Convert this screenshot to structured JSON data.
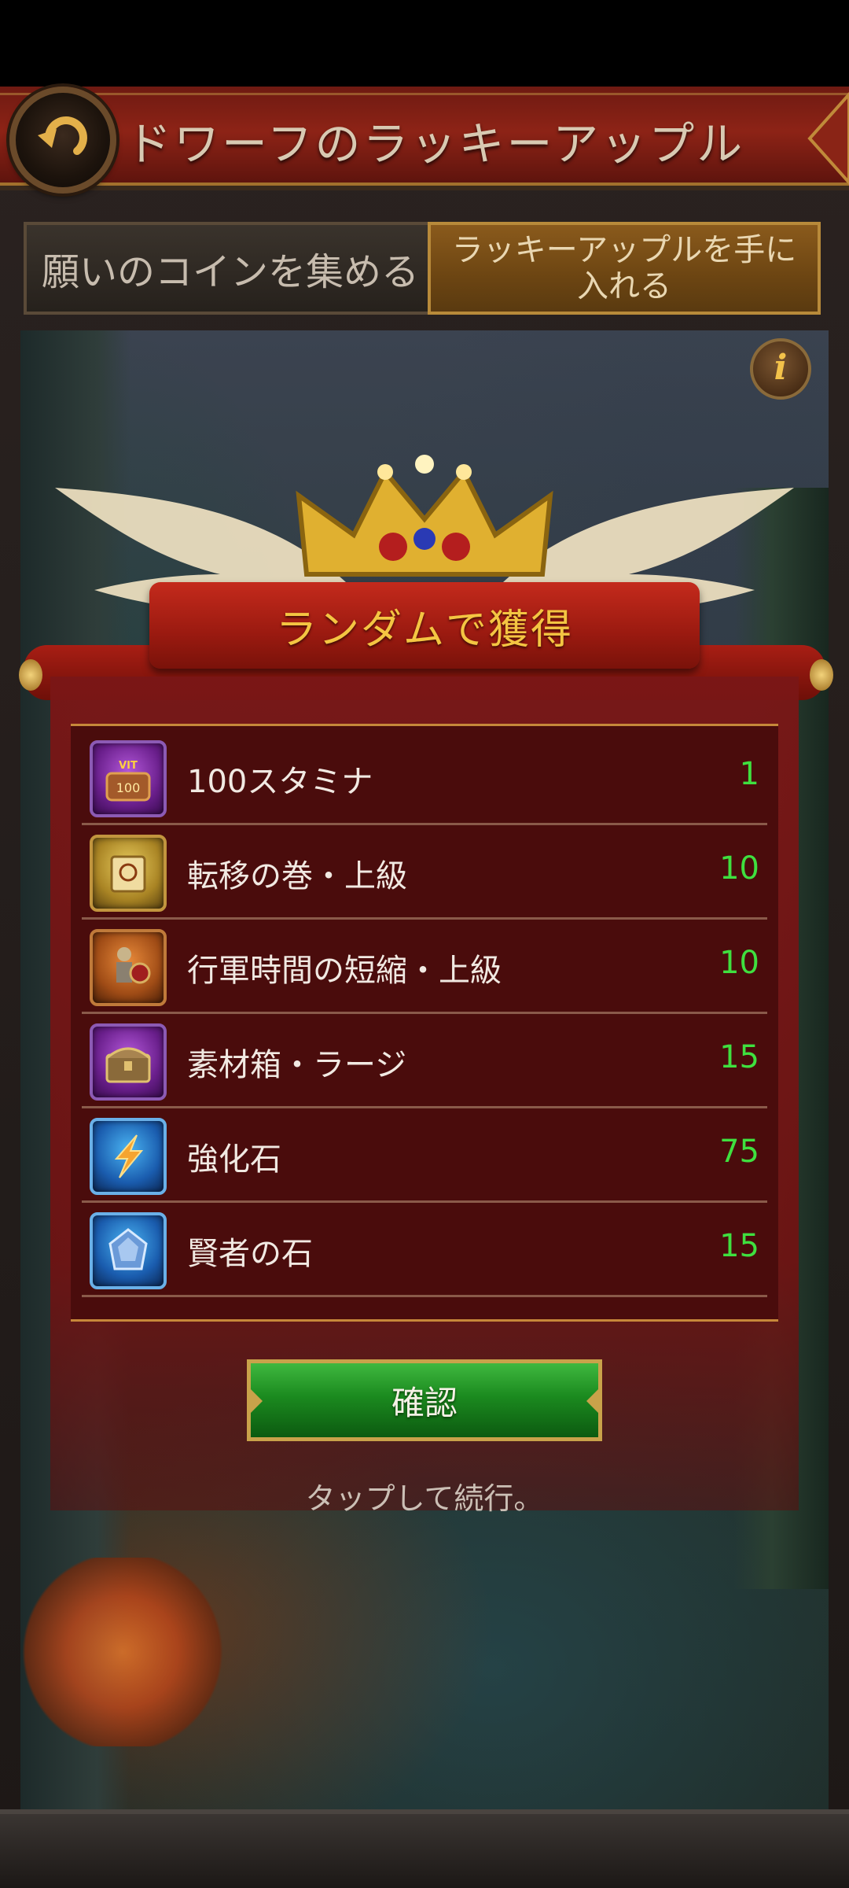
{
  "header": {
    "title": "ドワーフのラッキーアップル"
  },
  "tabs": {
    "collect_coins": "願いのコインを集める",
    "get_apple": "ラッキーアップルを手に入れる"
  },
  "reward": {
    "banner_title": "ランダムで獲得",
    "items": [
      {
        "name": "100スタミナ",
        "quantity": "1",
        "icon": "stamina-chest-icon",
        "icon_badge": "100",
        "icon_label": "VIT",
        "color": "#7a2aa0"
      },
      {
        "name": "転移の巻・上級",
        "quantity": "10",
        "icon": "teleport-scroll-icon",
        "color": "#b8922c"
      },
      {
        "name": "行軍時間の短縮・上級",
        "quantity": "10",
        "icon": "march-speedup-icon",
        "color": "#b35a1e"
      },
      {
        "name": "素材箱・ラージ",
        "quantity": "15",
        "icon": "material-chest-icon",
        "color": "#7a2aa0"
      },
      {
        "name": "強化石",
        "quantity": "75",
        "icon": "enhancement-stone-icon",
        "color": "#1f6ac0"
      },
      {
        "name": "賢者の石",
        "quantity": "15",
        "icon": "sage-stone-icon",
        "color": "#1f6ac0"
      }
    ],
    "confirm_label": "確認",
    "continue_hint": "タップして続行。"
  },
  "colors": {
    "quantity": "#3fe03f",
    "banner_text": "#f4c542",
    "panel": "#7a1616",
    "confirm": "#1b8a1f"
  }
}
